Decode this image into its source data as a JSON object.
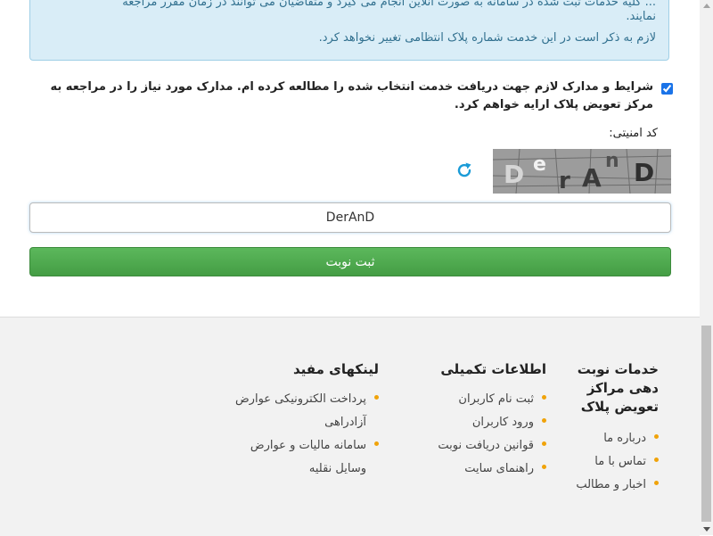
{
  "info_box": {
    "line1": "... کلیه خدمات ثبت شده در سامانه به صورت آنلاین انجام می گیرد و متقاضیان می توانند در زمان مقرر مراجعه",
    "line2": "نمایند.",
    "line3": "لازم به ذکر است در این خدمت شماره پلاک انتظامی تغییر نخواهد کرد."
  },
  "terms": {
    "checked": true,
    "text": "شرایط و مدارک لازم جهت دریافت خدمت انتخاب شده را مطالعه کرده ام. مدارک مورد نیاز را در مراجعه به مرکز تعویض پلاک ارایه خواهم کرد."
  },
  "captcha": {
    "label": "کد امنیتی:",
    "image_text": "DerAnD",
    "input_value": "DerAnD"
  },
  "submit_label": "ثبت نوبت",
  "footer": {
    "col1": {
      "title_lines": [
        "خدمات نوبت",
        "دهی مراکز",
        "تعویض پلاک"
      ],
      "links": [
        "درباره ما",
        "تماس با ما",
        "اخبار و مطالب"
      ]
    },
    "col2": {
      "title": "اطلاعات تکمیلی",
      "links": [
        "ثبت نام کاربران",
        "ورود کاربران",
        "قوانین دریافت نوبت",
        "راهنمای سایت"
      ]
    },
    "col3": {
      "title": "لینکهای مفید",
      "links": [
        "پرداخت الکترونیکی عوارض",
        "آزادراهی",
        "سامانه مالیات و عوارض",
        "وسایل نقلیه"
      ]
    }
  },
  "colors": {
    "info_bg": "#d9edf7",
    "success_button": "#5cb85c",
    "bullet": "#f0a30a",
    "refresh_icon": "#1a9bd7"
  }
}
